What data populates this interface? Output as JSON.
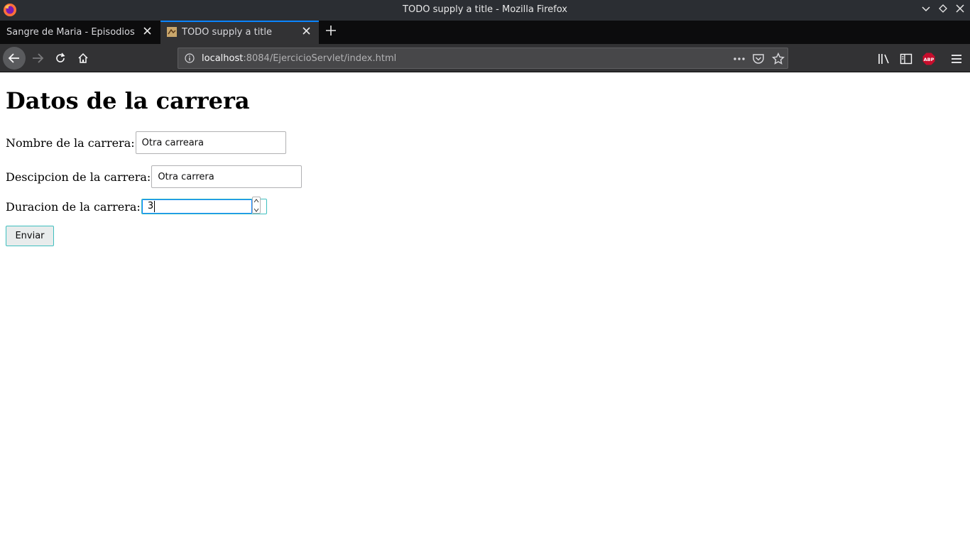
{
  "window": {
    "title": "TODO supply a title - Mozilla Firefox",
    "icons": [
      "firefox-logo",
      "chevron-down-icon",
      "diamond-icon",
      "close-icon"
    ]
  },
  "tabs": [
    {
      "label": "Sangre de Maria - Episodios co",
      "active": false
    },
    {
      "label": "TODO supply a title",
      "active": true
    }
  ],
  "navbar": {
    "url_host": "localhost",
    "url_path": ":8084/EjercicioServlet/index.html"
  },
  "page": {
    "heading": "Datos de la carrera",
    "fields": {
      "nombre_label": "Nombre de la carrera:",
      "nombre_value": "Otra carreara",
      "descripcion_label": "Descipcion de la carrera:",
      "descripcion_value": "Otra carrera",
      "duracion_label": "Duracion de la carrera:",
      "duracion_value": "3"
    },
    "submit_label": "Enviar"
  },
  "colors": {
    "accent": "#0a84ff",
    "focus_outline": "#3fbfbf",
    "chrome_dark": "#323234"
  }
}
